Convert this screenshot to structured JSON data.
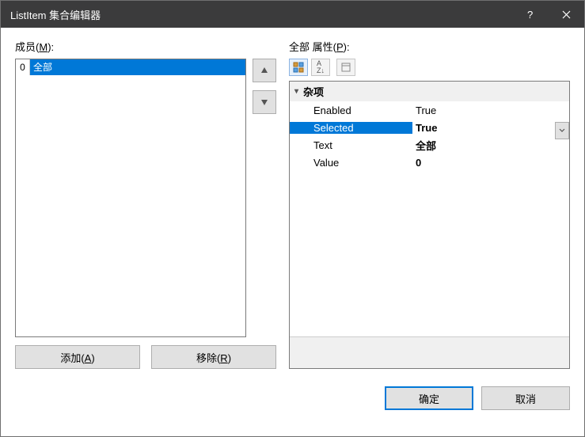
{
  "window": {
    "title": "ListItem 集合编辑器"
  },
  "left": {
    "label_prefix": "成员(",
    "label_mnemonic": "M",
    "label_suffix": "):",
    "members": [
      {
        "index": "0",
        "text": "全部"
      }
    ],
    "add_label": "添加(A)",
    "remove_label": "移除(R)"
  },
  "right": {
    "label_prefix": "全部 属性(",
    "label_mnemonic": "P",
    "label_suffix": "):",
    "category": "杂项",
    "props": {
      "enabled_name": "Enabled",
      "enabled_val": "True",
      "selected_name": "Selected",
      "selected_val": "True",
      "text_name": "Text",
      "text_val": "全部",
      "value_name": "Value",
      "value_val": "0"
    }
  },
  "footer": {
    "ok": "确定",
    "cancel": "取消"
  }
}
